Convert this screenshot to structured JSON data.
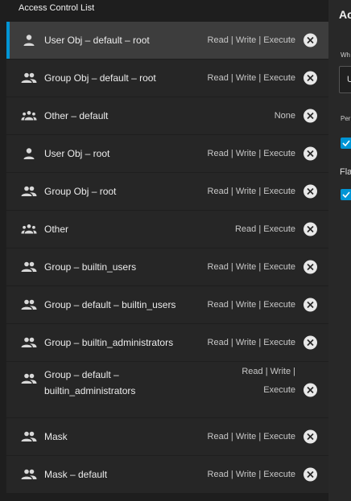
{
  "acl": {
    "title": "Access Control List",
    "entries": [
      {
        "label": "User Obj – default – root",
        "perms": "Read | Write | Execute",
        "icon": "user-icon"
      },
      {
        "label": "Group Obj – default – root",
        "perms": "Read | Write | Execute",
        "icon": "group-icon"
      },
      {
        "label": "Other – default",
        "perms": "None",
        "icon": "others-icon"
      },
      {
        "label": "User Obj – root",
        "perms": "Read | Write | Execute",
        "icon": "user-icon"
      },
      {
        "label": "Group Obj – root",
        "perms": "Read | Write | Execute",
        "icon": "group-icon"
      },
      {
        "label": "Other",
        "perms": "Read | Execute",
        "icon": "others-icon"
      },
      {
        "label": "Group – builtin_users",
        "perms": "Read | Write | Execute",
        "icon": "group-icon"
      },
      {
        "label": "Group – default – builtin_users",
        "perms": "Read | Write | Execute",
        "icon": "group-icon"
      },
      {
        "label": "Group – builtin_administrators",
        "perms": "Read | Write | Execute",
        "icon": "group-icon"
      },
      {
        "label_line1": "Group – default –",
        "label_line2": "builtin_administrators",
        "perms_line1": "Read | Write |",
        "perms_line2": "Execute",
        "icon": "group-icon"
      },
      {
        "label": "Mask",
        "perms": "Read | Write | Execute",
        "icon": "group-icon"
      },
      {
        "label": "Mask – default",
        "perms": "Read | Write | Execute",
        "icon": "group-icon"
      }
    ]
  },
  "editor": {
    "title": "Ac",
    "who_label": "Wh",
    "who_value": "U",
    "permissions_label": "Per",
    "flags_label": "Fla"
  },
  "colors": {
    "accent": "#0095d5",
    "background": "#1e1e1e",
    "row": "#262626",
    "row_selected": "#3d3d3d"
  }
}
